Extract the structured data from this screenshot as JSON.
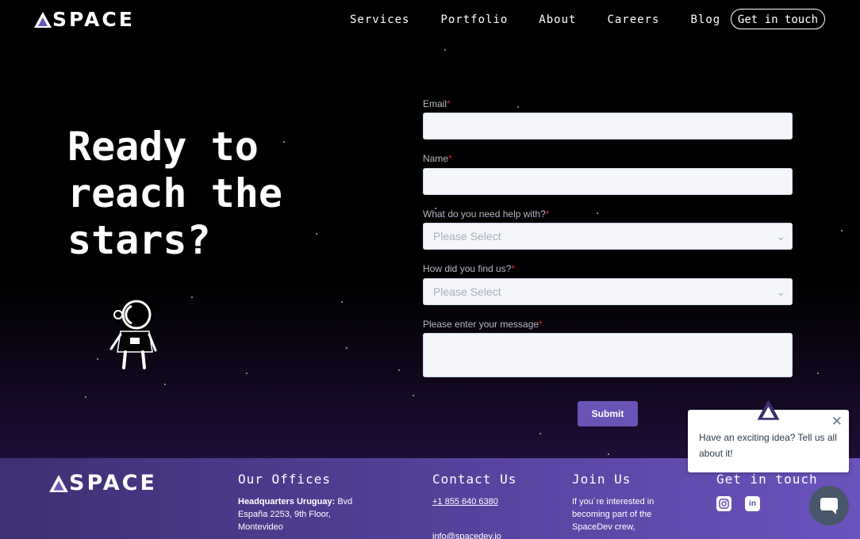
{
  "brand": {
    "logo_text": "SPACE"
  },
  "nav": {
    "items": [
      "Services",
      "Portfolio",
      "About",
      "Careers",
      "Blog"
    ],
    "cta": "Get in touch"
  },
  "hero": {
    "headline_lines": [
      "Ready to",
      "reach the",
      "stars?"
    ]
  },
  "form": {
    "email_label": "Email",
    "name_label": "Name",
    "help_label": "What do you need help with?",
    "help_value": "Please Select",
    "source_label": "How did you find us?",
    "source_value": "Please Select",
    "message_label": "Please enter your message",
    "required_mark": "*",
    "submit_label": "Submit"
  },
  "footer": {
    "logo_text": "SPACE",
    "offices_heading": "Our Offices",
    "offices_bold": "Headquarters Uruguay:",
    "offices_text": "Bvd España 2253, 9th Floor, Montevideo",
    "contact_heading": "Contact Us",
    "phone": "+1 855 640 6380",
    "email": "info@spacedev.io",
    "join_heading": "Join Us",
    "join_text": "If you´re interested in becoming part of the SpaceDev crew,",
    "touch_heading": "Get in touch",
    "social_icons": [
      "instagram-icon",
      "linkedin-icon"
    ]
  },
  "chat": {
    "bubble_text": "Have an exciting idea? Tell us all about it!",
    "close_icon": "close-icon",
    "launcher_icon": "chat-icon"
  },
  "colors": {
    "accent": "#6a53b7",
    "footer_start": "#3e2f72",
    "footer_end": "#6a53bd",
    "required": "#e0262b"
  }
}
